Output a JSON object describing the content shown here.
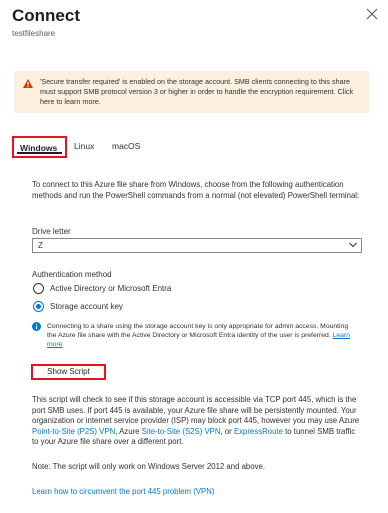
{
  "header": {
    "title": "Connect",
    "subtitle": "testfileshare"
  },
  "warning": {
    "text": "'Secure transfer required' is enabled on the storage account. SMB clients connecting to this share must support SMB protocol version 3 or higher in order to handle the encryption requirement. Click here to learn more."
  },
  "tabs": [
    {
      "label": "Windows",
      "selected": true
    },
    {
      "label": "Linux",
      "selected": false
    },
    {
      "label": "macOS",
      "selected": false
    }
  ],
  "main": {
    "description": "To connect to this Azure file share from Windows, choose from the following authentication methods and run the PowerShell commands from a normal (not elevated) PowerShell terminal:",
    "drive_letter_label": "Drive letter",
    "drive_letter_value": "Z",
    "auth_label": "Authentication method",
    "auth_options": [
      {
        "label": "Active Directory or Microsoft Entra",
        "checked": false
      },
      {
        "label": "Storage account key",
        "checked": true
      }
    ],
    "info_text": "Connecting to a share using the storage account key is only appropriate for admin access. Mounting the Azure file share with the Active Directory or Microsoft Entra identity of the user is preferred.",
    "info_link": "Learn more",
    "show_script_label": "Show Script",
    "port_text_1": "This script will check to see if this storage account is accessible via TCP port 445, which is the port SMB uses. If port 445 is available, your Azure file share will be persistently mounted. Your organization or internet service provider (ISP) may block port 445, however you may use Azure ",
    "p2s_link": "Point-to-Site (P2S) VPN",
    "port_text_2": ", Azure ",
    "s2s_link": "Site-to-Site (S2S) VPN",
    "port_text_3": ", or ",
    "expressroute_link": "ExpressRoute",
    "port_text_4": " to tunnel SMB traffic to your Azure file share over a different port.",
    "note": "Note: The script will only work on Windows Server 2012 and above.",
    "bottom_link": "Learn how to circumvent the port 445 problem (VPN)"
  },
  "colors": {
    "accent": "#0078d4",
    "highlight_border": "#e81123",
    "warning_bg": "#fdf0e0",
    "warning_icon": "#d83b01"
  }
}
